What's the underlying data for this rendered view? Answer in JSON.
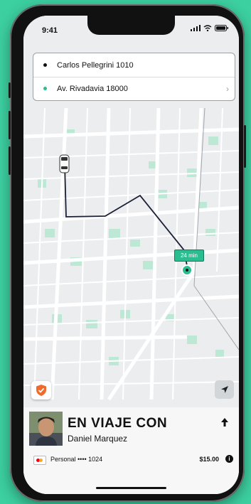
{
  "status_bar": {
    "time": "9:41"
  },
  "route": {
    "origin": "Carlos Pellegrini 1010",
    "destination": "Av. Rivadavia 18000"
  },
  "map": {
    "eta_badge": "24 min"
  },
  "trip": {
    "title": "EN VIAJE CON",
    "driver_name": "Daniel Marquez",
    "payment_label": "Personal •••• 1024",
    "price": "$15.00"
  },
  "colors": {
    "accent": "#2bbd8f",
    "background": "#3ccfa0",
    "map_base": "#ebedef",
    "route_line": "#1a1f36",
    "shield": "#f06a2b"
  },
  "icons": {
    "signal": "signal-icon",
    "wifi": "wifi-icon",
    "battery": "battery-icon",
    "chevron": "chevron-right-icon",
    "shield": "shield-check-icon",
    "locate": "navigation-arrow-icon",
    "expand": "arrow-up-icon",
    "info": "info-icon",
    "card": "mastercard-icon"
  }
}
